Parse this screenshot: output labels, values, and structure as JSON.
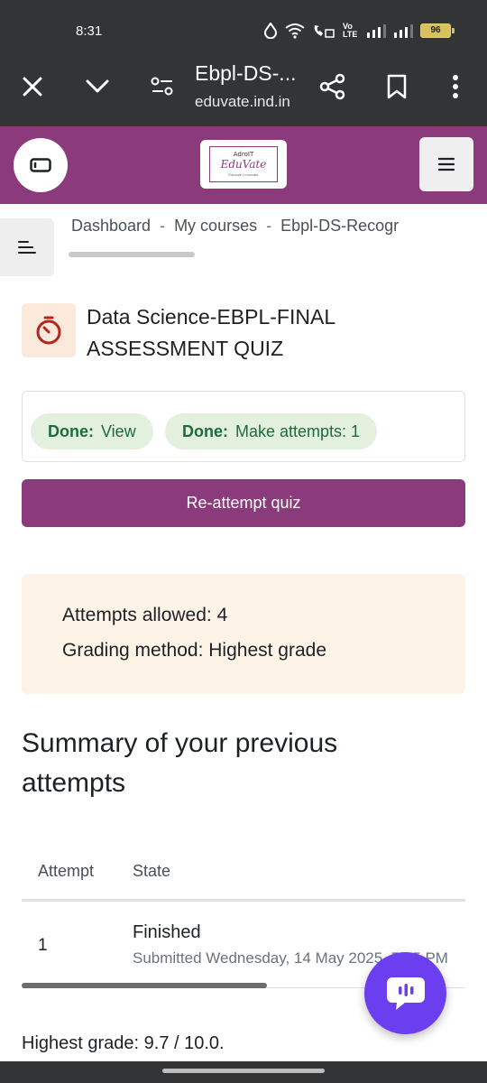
{
  "status_bar": {
    "time": "8:31",
    "battery": "96",
    "network_label": "Vo LTE"
  },
  "browser": {
    "title": "Ebpl-DS-...",
    "url": "eduvate.ind.in",
    "icons": [
      "close-icon",
      "chevron-down-icon",
      "page-settings-icon",
      "share-icon",
      "bookmark-icon",
      "more-vert-icon"
    ],
    "toolbar_color": "#333436"
  },
  "site": {
    "brand_color": "#8b3a7b",
    "logo_sub": "AdroIT",
    "logo_main": "EduVate",
    "logo_tag": "Educate | Innovate"
  },
  "breadcrumb": {
    "items": [
      "Dashboard",
      "My courses",
      "Ebpl-DS-Recogr"
    ],
    "separator": "-"
  },
  "quiz": {
    "title": "Data Science-EBPL-FINAL ASSESSMENT QUIZ",
    "icon": "stopwatch-icon"
  },
  "completion": {
    "items": [
      {
        "status": "Done:",
        "label": "View"
      },
      {
        "status": "Done:",
        "label": "Make attempts: 1"
      }
    ]
  },
  "actions": {
    "reattempt_label": "Re-attempt quiz"
  },
  "info": {
    "attempts_allowed": "Attempts allowed: 4",
    "grading_method": "Grading method: Highest grade"
  },
  "summary": {
    "heading": "Summary of your previous attempts",
    "columns": [
      "Attempt",
      "State"
    ],
    "rows": [
      {
        "attempt": "1",
        "state": "Finished",
        "submitted": "Submitted Wednesday, 14 May 2025, 7:05 PM"
      }
    ]
  },
  "highest_grade": "Highest grade: 9.7 / 10.0.",
  "chat": {
    "icon": "chat-bubble-icon",
    "color": "#6b3ef0"
  }
}
